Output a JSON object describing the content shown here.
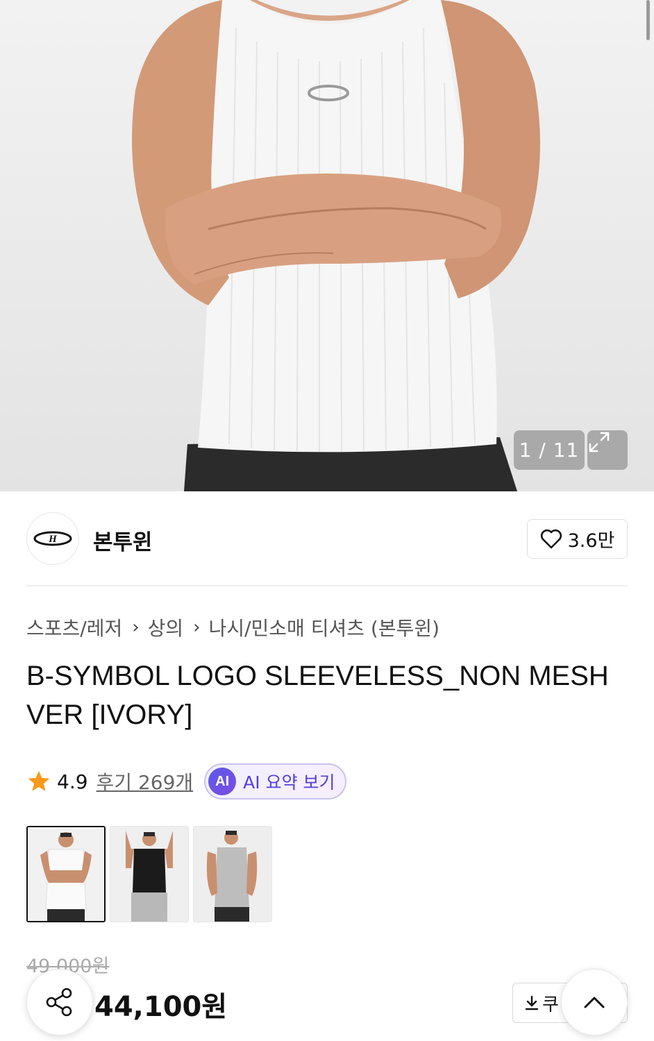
{
  "gallery": {
    "counter": "1 / 11",
    "image_alt": "Model wearing ivory ribbed sleeveless top with arms crossed"
  },
  "brand": {
    "name": "본투윈",
    "likes": "3.6만",
    "logo_icon": "brand-h-oval-logo"
  },
  "breadcrumb": {
    "items": [
      "스포츠/레저",
      "상의",
      "나시/민소매 티셔츠 (본투윈)"
    ]
  },
  "product": {
    "title": "B-SYMBOL LOGO SLEEVELESS_NON MESH VER [IVORY]",
    "rating": "4.9",
    "reviews": "후기 269개",
    "ai_badge_icon_text": "AI",
    "ai_summary_label": "AI 요약 보기",
    "original_price": "49,000원",
    "price": "44,100원"
  },
  "thumbnails": [
    {
      "color": "ivory",
      "selected": true
    },
    {
      "color": "black",
      "selected": false
    },
    {
      "color": "gray",
      "selected": false
    }
  ],
  "floating": {
    "coupon_label": "쿠",
    "share_icon": "share-icon",
    "top_icon": "chevron-up-icon"
  },
  "colors": {
    "star": "#f89a1c",
    "ai_accent": "#5240d8"
  }
}
